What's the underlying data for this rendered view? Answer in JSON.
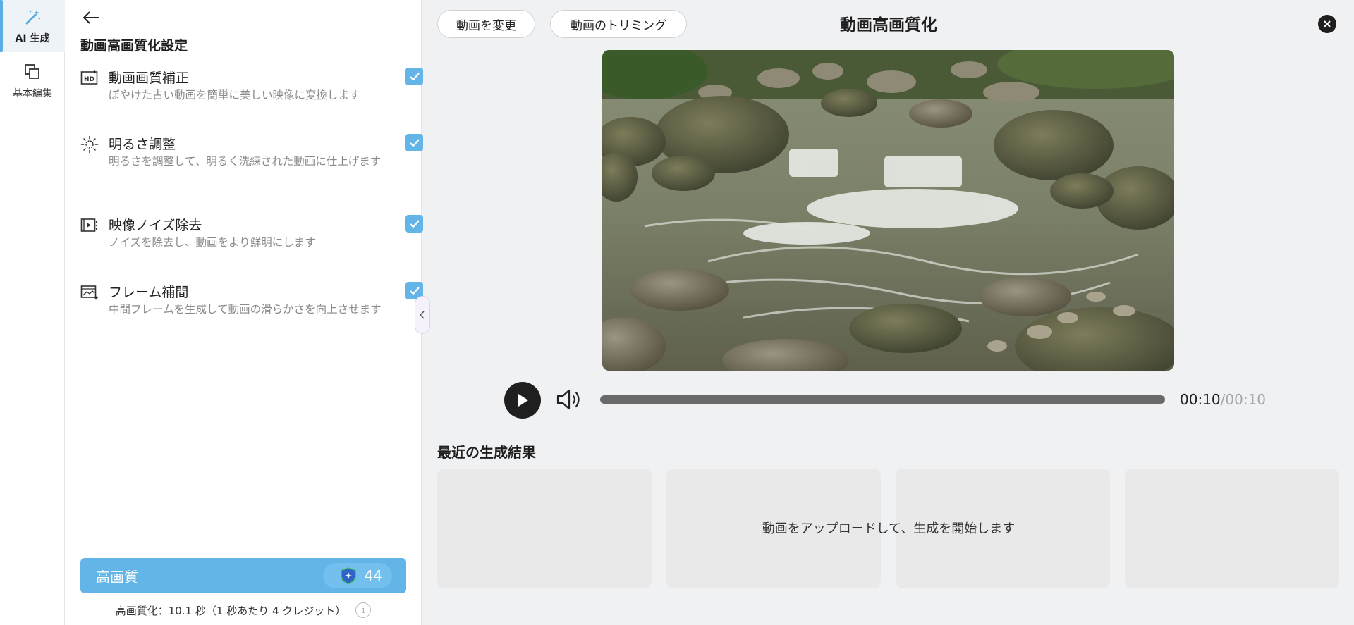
{
  "rail": {
    "items": [
      {
        "label": "AI 生成",
        "icon": "magic-wand-icon",
        "active": true
      },
      {
        "label": "基本編集",
        "icon": "copy-icon",
        "active": false
      }
    ]
  },
  "panel": {
    "title": "動画高画質化設定",
    "options": [
      {
        "title": "動画画質補正",
        "desc": "ぼやけた古い動画を簡単に美しい映像に変換します",
        "icon": "hd-icon",
        "checked": true
      },
      {
        "title": "明るさ調整",
        "desc": "明るさを調整して、明るく洗練された動画に仕上げます",
        "icon": "brightness-icon",
        "checked": true
      },
      {
        "title": "映像ノイズ除去",
        "desc": "ノイズを除去し、動画をより鮮明にします",
        "icon": "denoise-icon",
        "checked": true
      },
      {
        "title": "フレーム補間",
        "desc": "中間フレームを生成して動画の滑らかさを向上させます",
        "icon": "frame-icon",
        "checked": true
      }
    ],
    "cta_label": "高画質",
    "credits": "44",
    "cost_note": "高画質化：10.1 秒（1 秒あたり 4 クレジット）"
  },
  "header": {
    "change_video": "動画を変更",
    "trim_video": "動画のトリミング",
    "title": "動画高画質化"
  },
  "player": {
    "current_time": "00:10",
    "total_time": "/00:10",
    "progress": 1.0
  },
  "recent": {
    "title": "最近の生成結果",
    "empty_message": "動画をアップロードして、生成を開始します"
  },
  "colors": {
    "accent": "#63b5e8",
    "dark": "#1f1f1f",
    "card": "#e9e9ea"
  }
}
